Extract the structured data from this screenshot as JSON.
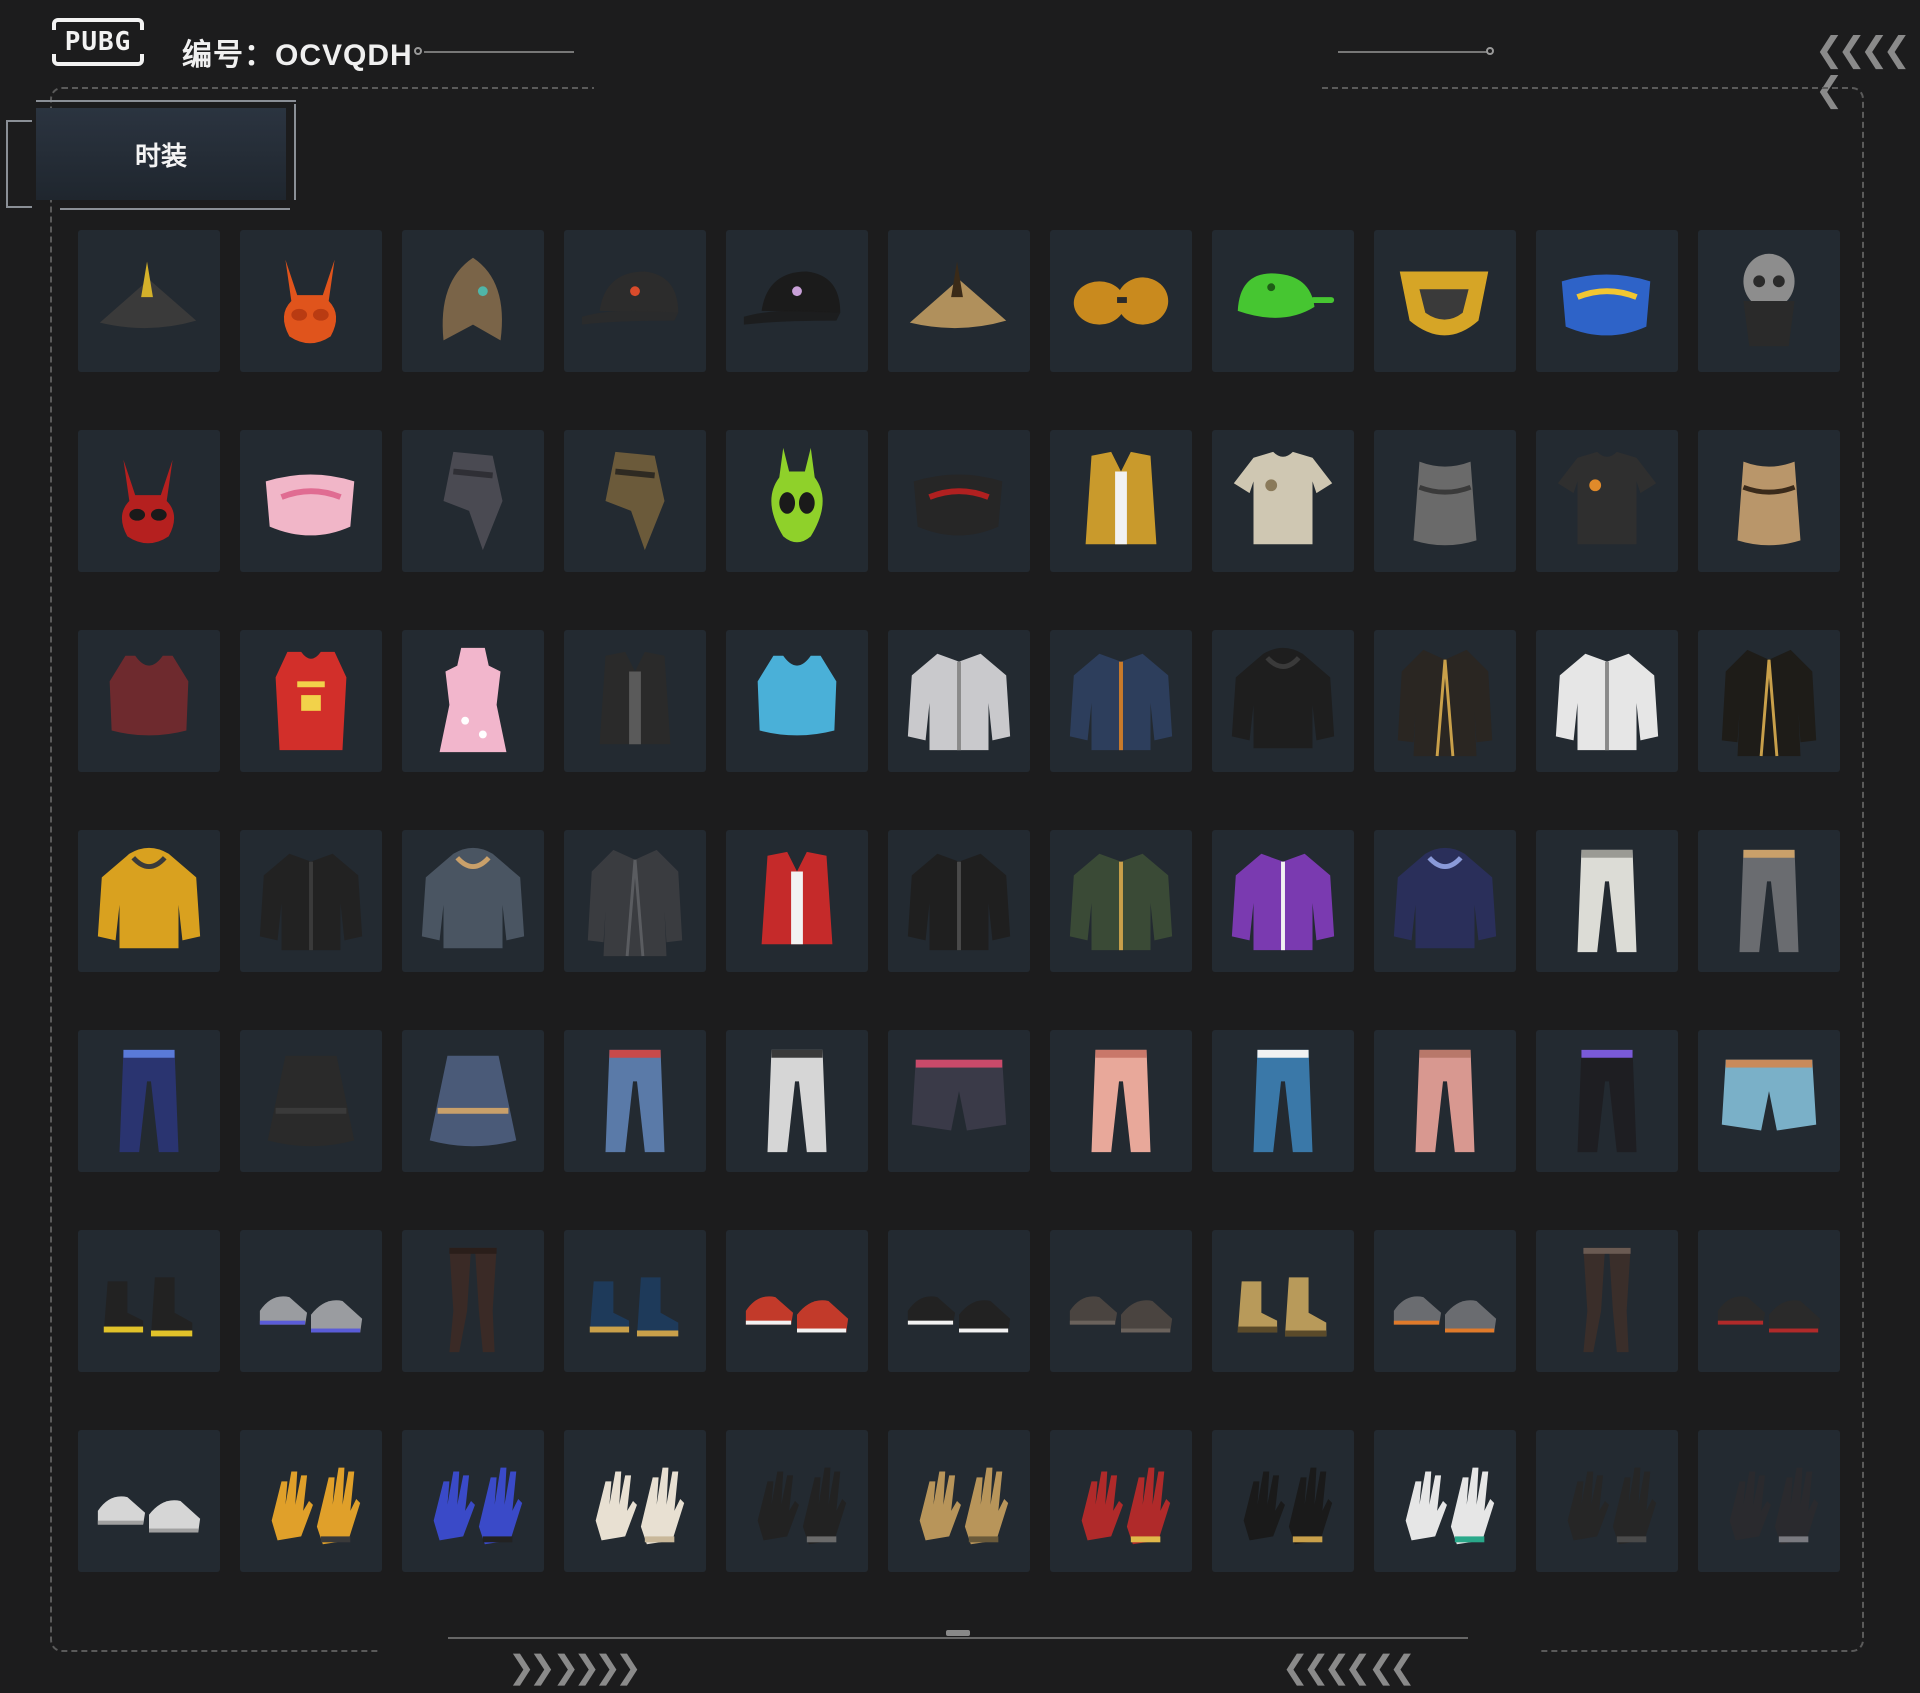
{
  "header": {
    "logo_text": "PUBG",
    "code_label": "编号：OCVQDH"
  },
  "tabs": [
    {
      "label": "时装",
      "active": true
    }
  ],
  "colors": {
    "background": "#1c1c1d",
    "cell": "#232a31",
    "accent_line": "#777777"
  },
  "items": [
    {
      "name": "feathered-tricorn-hat",
      "icon": "hat",
      "color": "#3a3a3a",
      "accent": "#d4b12a"
    },
    {
      "name": "orange-bunny-mask",
      "icon": "mask",
      "color": "#e0541c",
      "accent": "#b93b12"
    },
    {
      "name": "bronze-eagle-helmet",
      "icon": "helmet",
      "color": "#7a6448",
      "accent": "#4fb5a8"
    },
    {
      "name": "black-baseball-cap",
      "icon": "cap",
      "color": "#2c2c2c",
      "accent": "#d94b2b"
    },
    {
      "name": "black-cap-logo",
      "icon": "cap",
      "color": "#1b1b1b",
      "accent": "#c8a0d8"
    },
    {
      "name": "tan-bucket-hat",
      "icon": "hat",
      "color": "#b0905c",
      "accent": "#3a2a18"
    },
    {
      "name": "amber-goggles",
      "icon": "goggles",
      "color": "#c98a1e",
      "accent": "#2a2a2a"
    },
    {
      "name": "green-frog-hat",
      "icon": "frog",
      "color": "#46c631",
      "accent": "#1e5e16"
    },
    {
      "name": "gold-face-guard",
      "icon": "guard",
      "color": "#d6a526",
      "accent": "#3a3a3a"
    },
    {
      "name": "blue-graffiti-mask",
      "icon": "facemask",
      "color": "#2e63c8",
      "accent": "#f2c632"
    },
    {
      "name": "skull-balaclava",
      "icon": "skull",
      "color": "#8d8d8d",
      "accent": "#2a2a2a"
    },
    {
      "name": "red-demon-mask",
      "icon": "mask",
      "color": "#b5201f",
      "accent": "#1a1a1a"
    },
    {
      "name": "pink-face-mask",
      "icon": "facemask",
      "color": "#f1b6c8",
      "accent": "#e06c92"
    },
    {
      "name": "grey-scarf",
      "icon": "scarf",
      "color": "#4a4a52",
      "accent": "#2f2f35"
    },
    {
      "name": "camo-scarf",
      "icon": "scarf",
      "color": "#6b5a3a",
      "accent": "#2e2a22"
    },
    {
      "name": "green-alien-hood",
      "icon": "alien",
      "color": "#8fd12a",
      "accent": "#1a1a1a"
    },
    {
      "name": "black-quilted-mask",
      "icon": "facemask",
      "color": "#262626",
      "accent": "#b02020"
    },
    {
      "name": "gold-puffer-vest",
      "icon": "vest",
      "color": "#c99a2c",
      "accent": "#f2f2f2"
    },
    {
      "name": "beige-vest-shirt",
      "icon": "shirt",
      "color": "#cfc7b2",
      "accent": "#8a7a5a"
    },
    {
      "name": "grey-corset",
      "icon": "corset",
      "color": "#6a6a6a",
      "accent": "#3a3a3a"
    },
    {
      "name": "black-star-tshirt",
      "icon": "shirt",
      "color": "#2f2f2f",
      "accent": "#e08a2a"
    },
    {
      "name": "gold-tribal-top",
      "icon": "corset",
      "color": "#b9966a",
      "accent": "#3a2a1a"
    },
    {
      "name": "maroon-22-crop-top",
      "icon": "croptop",
      "color": "#6e2a2e",
      "accent": "#f2f2f2"
    },
    {
      "name": "red-23-jersey",
      "icon": "jersey",
      "color": "#d22f2a",
      "accent": "#f2d24a"
    },
    {
      "name": "pink-floral-qipao",
      "icon": "dress",
      "color": "#f2b6cc",
      "accent": "#ffffff"
    },
    {
      "name": "black-tactical-vest",
      "icon": "vest",
      "color": "#2a2a2a",
      "accent": "#5a5a5a"
    },
    {
      "name": "tie-dye-halter-top",
      "icon": "croptop",
      "color": "#4ab0d8",
      "accent": "#f2d24a"
    },
    {
      "name": "silver-bomber-jacket",
      "icon": "jacket",
      "color": "#c9c9cc",
      "accent": "#8a8a8a"
    },
    {
      "name": "denim-jacket",
      "icon": "jacket",
      "color": "#2d3e5c",
      "accent": "#c97a2a"
    },
    {
      "name": "black-hooded-cloak",
      "icon": "hoodie",
      "color": "#1e1e1e",
      "accent": "#3a3a3a"
    },
    {
      "name": "black-gold-coat",
      "icon": "coat",
      "color": "#2a2622",
      "accent": "#c9a04a"
    },
    {
      "name": "white-utility-jacket",
      "icon": "jacket",
      "color": "#e6e6e6",
      "accent": "#8a8a8a"
    },
    {
      "name": "black-gold-trench",
      "icon": "coat",
      "color": "#1e1c18",
      "accent": "#c9a04a"
    },
    {
      "name": "yellow-hoodie",
      "icon": "hoodie",
      "color": "#d9a11f",
      "accent": "#3a3a3a"
    },
    {
      "name": "black-jacket",
      "icon": "jacket",
      "color": "#222222",
      "accent": "#3a3a3a"
    },
    {
      "name": "grey-sweatshirt",
      "icon": "hoodie",
      "color": "#4a5562",
      "accent": "#c9a06a"
    },
    {
      "name": "charcoal-parka",
      "icon": "coat",
      "color": "#3a3c40",
      "accent": "#5a5c60"
    },
    {
      "name": "red-floral-vest",
      "icon": "vest",
      "color": "#c52a2a",
      "accent": "#f2f2f2"
    },
    {
      "name": "black-leather-jacket",
      "icon": "jacket",
      "color": "#1f1f1f",
      "accent": "#4a4a4a"
    },
    {
      "name": "olive-bomber",
      "icon": "jacket",
      "color": "#3a4a36",
      "accent": "#c9a04a"
    },
    {
      "name": "purple-colorblock-jacket",
      "icon": "jacket",
      "color": "#7a3ab0",
      "accent": "#f2f2f2"
    },
    {
      "name": "navy-sash-sweater",
      "icon": "hoodie",
      "color": "#2a2f5a",
      "accent": "#8a9ad8"
    },
    {
      "name": "white-trousers",
      "icon": "pants",
      "color": "#dcdcd6",
      "accent": "#9a9a94"
    },
    {
      "name": "grey-cargo-pants",
      "icon": "pants",
      "color": "#6a6c70",
      "accent": "#c9a06a"
    },
    {
      "name": "blue-camo-leggings",
      "icon": "pants",
      "color": "#2a3470",
      "accent": "#5a7ad8"
    },
    {
      "name": "black-draped-skirt",
      "icon": "skirt",
      "color": "#2a2a2a",
      "accent": "#3a3a3a"
    },
    {
      "name": "aztec-print-skirt",
      "icon": "skirt",
      "color": "#4a5a78",
      "accent": "#c9a06a"
    },
    {
      "name": "blue-jeans",
      "icon": "pants",
      "color": "#5a7aa8",
      "accent": "#c94a4a"
    },
    {
      "name": "white-graffiti-pants",
      "icon": "pants",
      "color": "#d6d6d6",
      "accent": "#3a3a3a"
    },
    {
      "name": "denim-shorts-stockings",
      "icon": "shorts",
      "color": "#3a3a48",
      "accent": "#c94a6a"
    },
    {
      "name": "pink-jogger-pants",
      "icon": "pants",
      "color": "#e8a89a",
      "accent": "#c9786a"
    },
    {
      "name": "patched-blue-jeans",
      "icon": "pants",
      "color": "#3a78a8",
      "accent": "#f2f2f2"
    },
    {
      "name": "pink-track-pants",
      "icon": "pants",
      "color": "#d89890",
      "accent": "#b8786a"
    },
    {
      "name": "black-track-pants",
      "icon": "pants",
      "color": "#1e1e22",
      "accent": "#7a5ad8"
    },
    {
      "name": "light-blue-shorts",
      "icon": "shorts",
      "color": "#7ab0c8",
      "accent": "#c98a5a"
    },
    {
      "name": "yellow-black-boots",
      "icon": "boots",
      "color": "#222222",
      "accent": "#e0c22a"
    },
    {
      "name": "grey-running-shoes",
      "icon": "shoes",
      "color": "#9a9ca0",
      "accent": "#5a5cd8"
    },
    {
      "name": "brown-tights",
      "icon": "tights",
      "color": "#3a2a26",
      "accent": "#2a1e1a"
    },
    {
      "name": "blue-thigh-boots",
      "icon": "boots",
      "color": "#1e3a5a",
      "accent": "#c9a04a"
    },
    {
      "name": "red-high-tops",
      "icon": "shoes",
      "color": "#c23a2a",
      "accent": "#f2f2f2"
    },
    {
      "name": "black-white-sneakers",
      "icon": "shoes",
      "color": "#222222",
      "accent": "#f2f2f2"
    },
    {
      "name": "paw-slippers",
      "icon": "shoes",
      "color": "#4a4440",
      "accent": "#6a625c"
    },
    {
      "name": "tan-work-boots",
      "icon": "boots",
      "color": "#b89a5a",
      "accent": "#5a4a2a"
    },
    {
      "name": "grey-orange-sneakers",
      "icon": "shoes",
      "color": "#6a6c70",
      "accent": "#e07a2a"
    },
    {
      "name": "patterned-stockings",
      "icon": "tights",
      "color": "#3a2e2a",
      "accent": "#6a5a52"
    },
    {
      "name": "black-red-sneakers",
      "icon": "shoes",
      "color": "#2a2a2a",
      "accent": "#b02a2a"
    },
    {
      "name": "white-sneakers",
      "icon": "shoes",
      "color": "#d6d6d6",
      "accent": "#a0a0a0"
    },
    {
      "name": "orange-fingerless-gloves",
      "icon": "gloves",
      "color": "#e0a02a",
      "accent": "#3a3a3a"
    },
    {
      "name": "blue-tactical-gloves",
      "icon": "gloves",
      "color": "#3a4ac8",
      "accent": "#222222"
    },
    {
      "name": "white-gloves",
      "icon": "gloves",
      "color": "#e8e0d2",
      "accent": "#c9b89a"
    },
    {
      "name": "black-claw-gloves",
      "icon": "gloves",
      "color": "#222222",
      "accent": "#6a6a6a"
    },
    {
      "name": "gold-gauntlet",
      "icon": "gloves",
      "color": "#b8955a",
      "accent": "#6a5a3a"
    },
    {
      "name": "red-gold-gloves",
      "icon": "gloves",
      "color": "#b02a2a",
      "accent": "#e0b84a"
    },
    {
      "name": "black-ring-gloves",
      "icon": "gloves",
      "color": "#1a1a1a",
      "accent": "#c9a04a"
    },
    {
      "name": "white-hand-ring",
      "icon": "gloves",
      "color": "#e6e6e6",
      "accent": "#2aa88a"
    },
    {
      "name": "black-leather-gloves",
      "icon": "gloves",
      "color": "#262626",
      "accent": "#4a4a4a"
    },
    {
      "name": "black-armored-gloves",
      "icon": "gloves",
      "color": "#2a2a2e",
      "accent": "#7a7a80"
    }
  ]
}
